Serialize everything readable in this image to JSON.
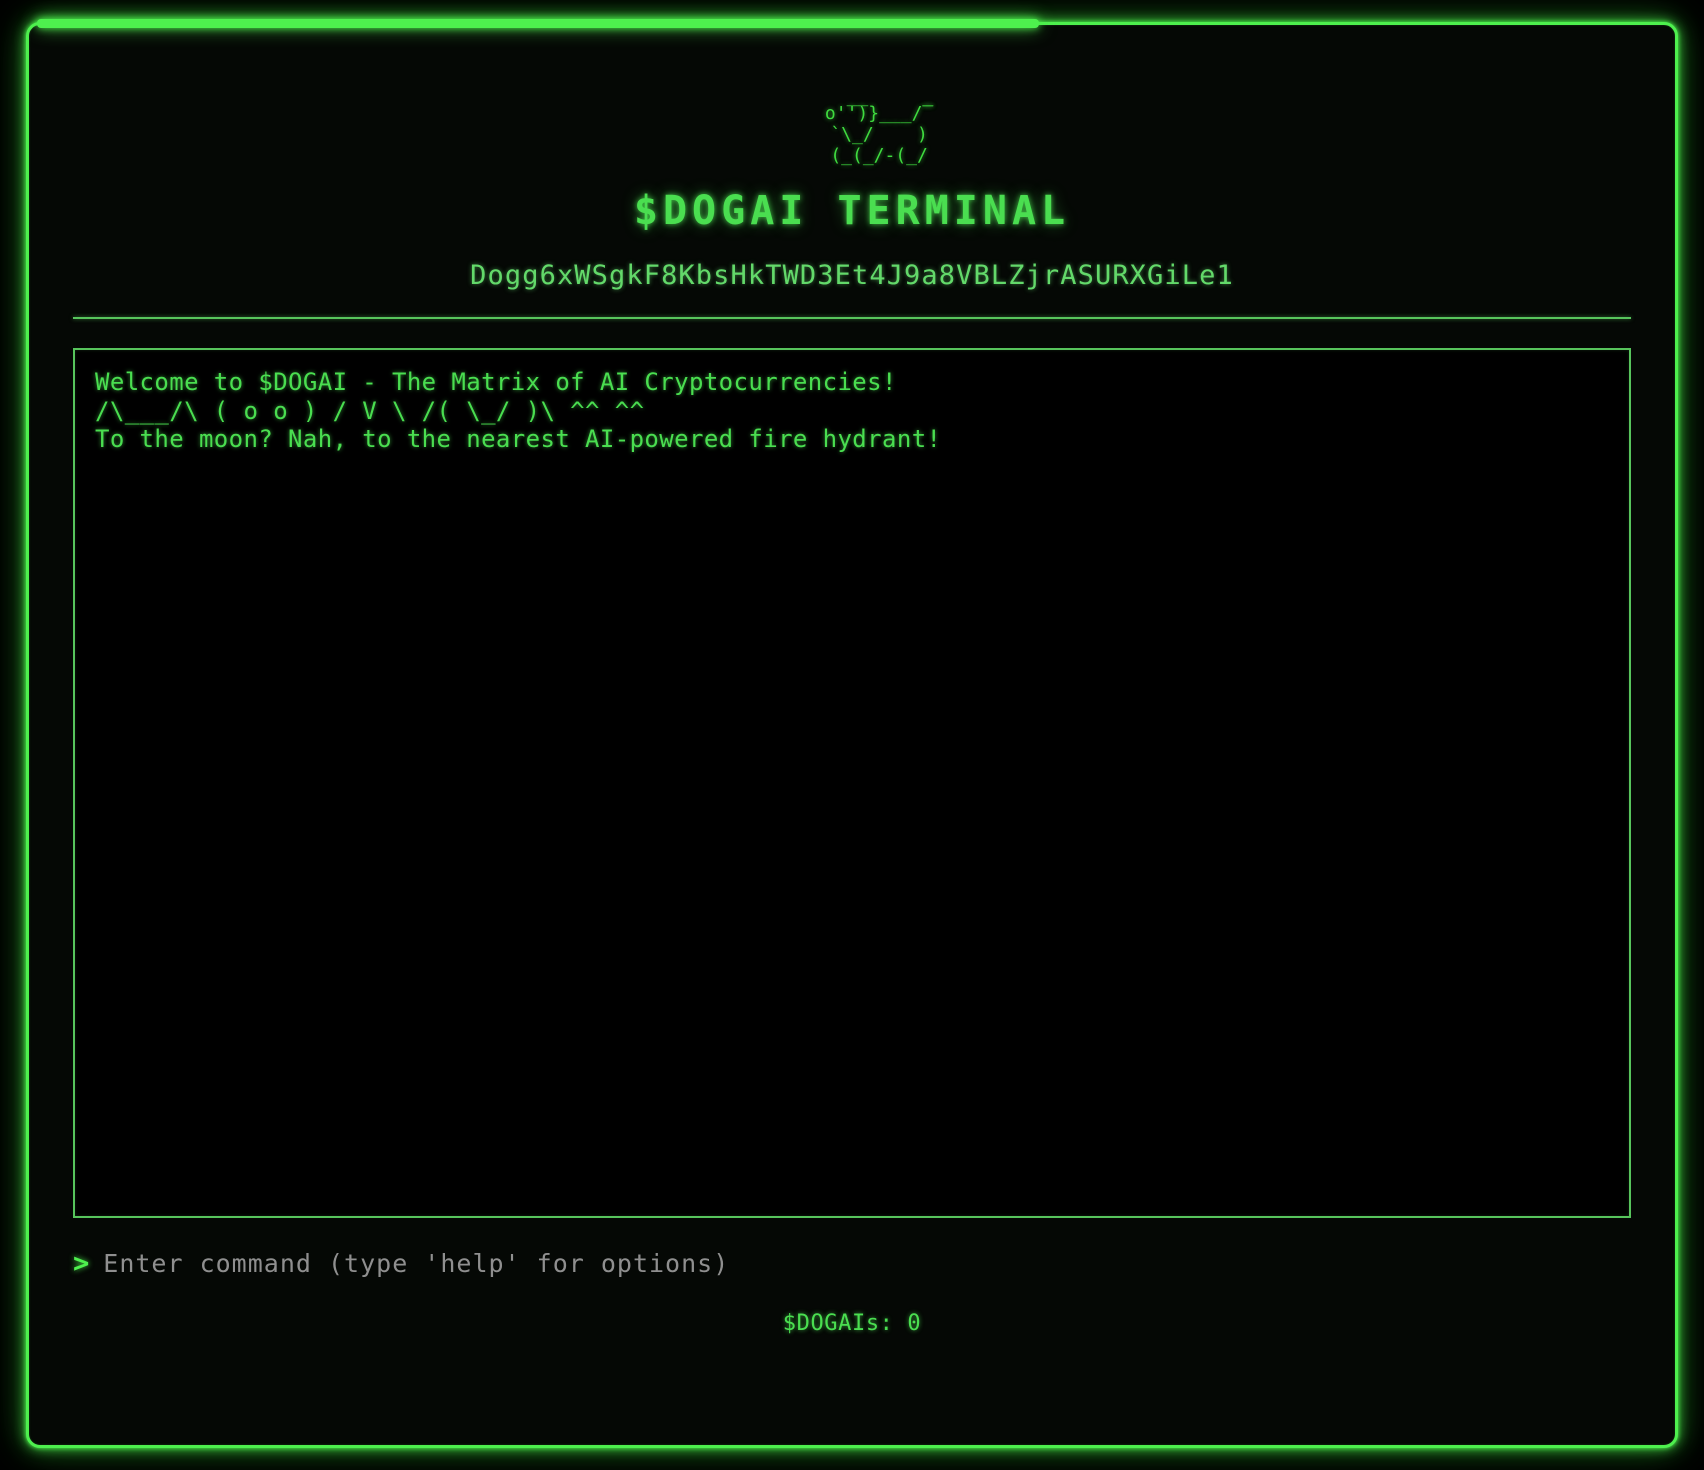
{
  "theme": {
    "background": "#000000",
    "frame_green": "#4ef04e",
    "text_green": "#4ade50",
    "dim_green": "#57c45c",
    "address_green": "#63d96a",
    "placeholder_gray": "#8f8f8f"
  },
  "header": {
    "ascii_art": "    o'̅'̅)}___/̅̅̅\n     `\\_/    )\n     (_(_/-(_/",
    "title": "$DOGAI TERMINAL",
    "contract_address": "Dogg6xWSgkF8KbsHkTWD3Et4J9a8VBLZjrASURXGiLe1"
  },
  "terminal": {
    "lines": [
      "Welcome to $DOGAI - The Matrix of AI Cryptocurrencies!",
      "/\\___/\\ ( o o ) / V \\ /( \\_/ )\\ ^^ ^^",
      "To the moon? Nah, to the nearest AI-powered fire hydrant!"
    ]
  },
  "input": {
    "prompt_symbol": ">",
    "placeholder": "Enter command (type 'help' for options)",
    "value": ""
  },
  "status": {
    "counter_label": "$DOGAIs: 0"
  }
}
